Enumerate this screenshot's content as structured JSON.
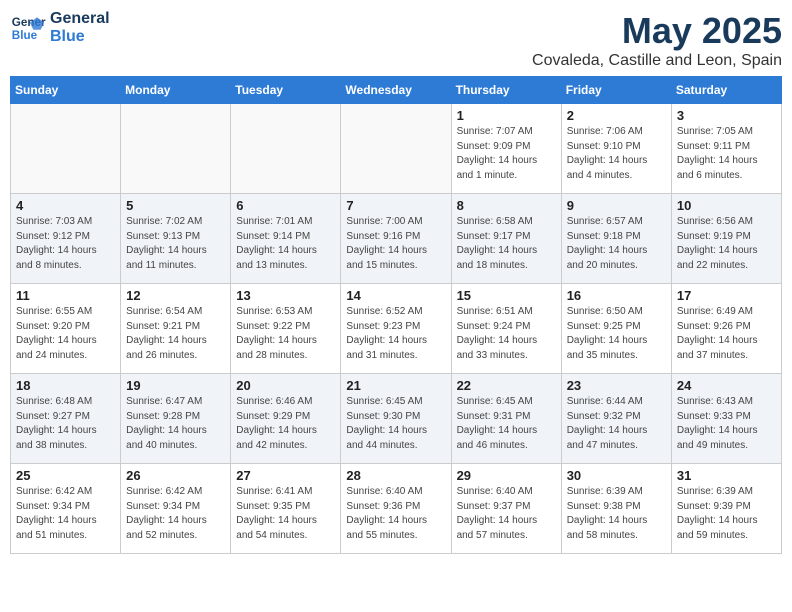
{
  "logo": {
    "line1": "General",
    "line2": "Blue"
  },
  "title": "May 2025",
  "location": "Covaleda, Castille and Leon, Spain",
  "days_of_week": [
    "Sunday",
    "Monday",
    "Tuesday",
    "Wednesday",
    "Thursday",
    "Friday",
    "Saturday"
  ],
  "weeks": [
    [
      {
        "num": "",
        "info": ""
      },
      {
        "num": "",
        "info": ""
      },
      {
        "num": "",
        "info": ""
      },
      {
        "num": "",
        "info": ""
      },
      {
        "num": "1",
        "info": "Sunrise: 7:07 AM\nSunset: 9:09 PM\nDaylight: 14 hours\nand 1 minute."
      },
      {
        "num": "2",
        "info": "Sunrise: 7:06 AM\nSunset: 9:10 PM\nDaylight: 14 hours\nand 4 minutes."
      },
      {
        "num": "3",
        "info": "Sunrise: 7:05 AM\nSunset: 9:11 PM\nDaylight: 14 hours\nand 6 minutes."
      }
    ],
    [
      {
        "num": "4",
        "info": "Sunrise: 7:03 AM\nSunset: 9:12 PM\nDaylight: 14 hours\nand 8 minutes."
      },
      {
        "num": "5",
        "info": "Sunrise: 7:02 AM\nSunset: 9:13 PM\nDaylight: 14 hours\nand 11 minutes."
      },
      {
        "num": "6",
        "info": "Sunrise: 7:01 AM\nSunset: 9:14 PM\nDaylight: 14 hours\nand 13 minutes."
      },
      {
        "num": "7",
        "info": "Sunrise: 7:00 AM\nSunset: 9:16 PM\nDaylight: 14 hours\nand 15 minutes."
      },
      {
        "num": "8",
        "info": "Sunrise: 6:58 AM\nSunset: 9:17 PM\nDaylight: 14 hours\nand 18 minutes."
      },
      {
        "num": "9",
        "info": "Sunrise: 6:57 AM\nSunset: 9:18 PM\nDaylight: 14 hours\nand 20 minutes."
      },
      {
        "num": "10",
        "info": "Sunrise: 6:56 AM\nSunset: 9:19 PM\nDaylight: 14 hours\nand 22 minutes."
      }
    ],
    [
      {
        "num": "11",
        "info": "Sunrise: 6:55 AM\nSunset: 9:20 PM\nDaylight: 14 hours\nand 24 minutes."
      },
      {
        "num": "12",
        "info": "Sunrise: 6:54 AM\nSunset: 9:21 PM\nDaylight: 14 hours\nand 26 minutes."
      },
      {
        "num": "13",
        "info": "Sunrise: 6:53 AM\nSunset: 9:22 PM\nDaylight: 14 hours\nand 28 minutes."
      },
      {
        "num": "14",
        "info": "Sunrise: 6:52 AM\nSunset: 9:23 PM\nDaylight: 14 hours\nand 31 minutes."
      },
      {
        "num": "15",
        "info": "Sunrise: 6:51 AM\nSunset: 9:24 PM\nDaylight: 14 hours\nand 33 minutes."
      },
      {
        "num": "16",
        "info": "Sunrise: 6:50 AM\nSunset: 9:25 PM\nDaylight: 14 hours\nand 35 minutes."
      },
      {
        "num": "17",
        "info": "Sunrise: 6:49 AM\nSunset: 9:26 PM\nDaylight: 14 hours\nand 37 minutes."
      }
    ],
    [
      {
        "num": "18",
        "info": "Sunrise: 6:48 AM\nSunset: 9:27 PM\nDaylight: 14 hours\nand 38 minutes."
      },
      {
        "num": "19",
        "info": "Sunrise: 6:47 AM\nSunset: 9:28 PM\nDaylight: 14 hours\nand 40 minutes."
      },
      {
        "num": "20",
        "info": "Sunrise: 6:46 AM\nSunset: 9:29 PM\nDaylight: 14 hours\nand 42 minutes."
      },
      {
        "num": "21",
        "info": "Sunrise: 6:45 AM\nSunset: 9:30 PM\nDaylight: 14 hours\nand 44 minutes."
      },
      {
        "num": "22",
        "info": "Sunrise: 6:45 AM\nSunset: 9:31 PM\nDaylight: 14 hours\nand 46 minutes."
      },
      {
        "num": "23",
        "info": "Sunrise: 6:44 AM\nSunset: 9:32 PM\nDaylight: 14 hours\nand 47 minutes."
      },
      {
        "num": "24",
        "info": "Sunrise: 6:43 AM\nSunset: 9:33 PM\nDaylight: 14 hours\nand 49 minutes."
      }
    ],
    [
      {
        "num": "25",
        "info": "Sunrise: 6:42 AM\nSunset: 9:34 PM\nDaylight: 14 hours\nand 51 minutes."
      },
      {
        "num": "26",
        "info": "Sunrise: 6:42 AM\nSunset: 9:34 PM\nDaylight: 14 hours\nand 52 minutes."
      },
      {
        "num": "27",
        "info": "Sunrise: 6:41 AM\nSunset: 9:35 PM\nDaylight: 14 hours\nand 54 minutes."
      },
      {
        "num": "28",
        "info": "Sunrise: 6:40 AM\nSunset: 9:36 PM\nDaylight: 14 hours\nand 55 minutes."
      },
      {
        "num": "29",
        "info": "Sunrise: 6:40 AM\nSunset: 9:37 PM\nDaylight: 14 hours\nand 57 minutes."
      },
      {
        "num": "30",
        "info": "Sunrise: 6:39 AM\nSunset: 9:38 PM\nDaylight: 14 hours\nand 58 minutes."
      },
      {
        "num": "31",
        "info": "Sunrise: 6:39 AM\nSunset: 9:39 PM\nDaylight: 14 hours\nand 59 minutes."
      }
    ]
  ]
}
